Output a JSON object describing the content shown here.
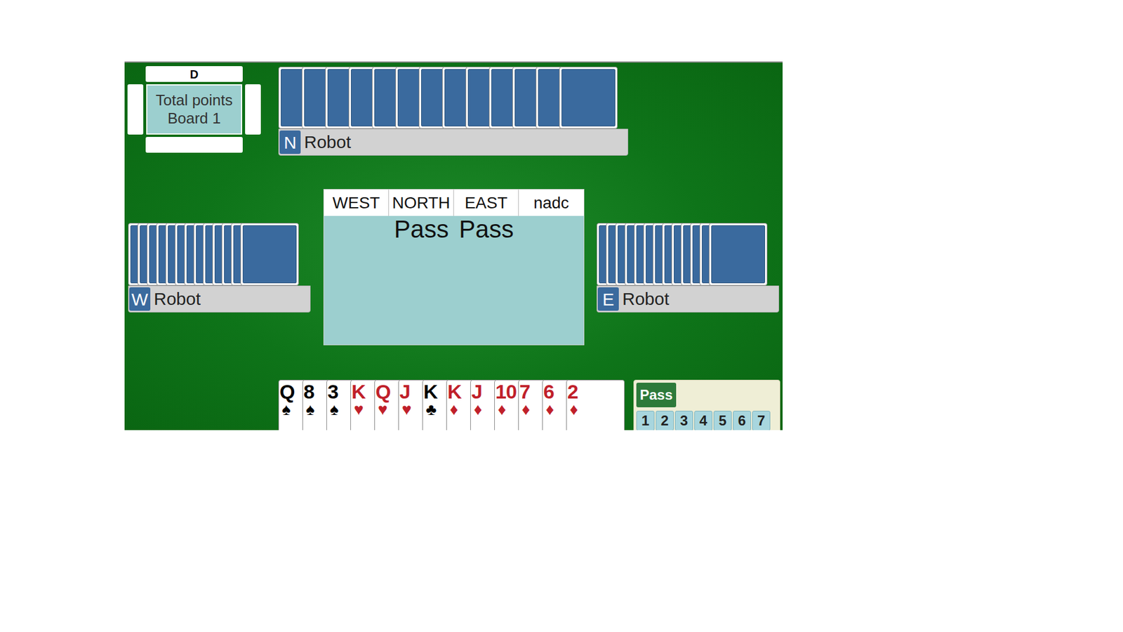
{
  "board": {
    "dealer_label": "D",
    "title": "Total points",
    "board": "Board 1"
  },
  "players": [
    {
      "seat": "N",
      "name": "Robot",
      "cards": 13
    },
    {
      "seat": "W",
      "name": "Robot",
      "cards": 13
    },
    {
      "seat": "E",
      "name": "Robot",
      "cards": 13
    }
  ],
  "auction": {
    "columns": [
      "WEST",
      "NORTH",
      "EAST",
      "nadc"
    ],
    "calls": [
      {
        "column": "NORTH",
        "text": "Pass"
      },
      {
        "column": "EAST",
        "text": "Pass"
      }
    ]
  },
  "hand": [
    {
      "rank": "Q",
      "suit": "♠",
      "color": "#000000"
    },
    {
      "rank": "8",
      "suit": "♠",
      "color": "#000000"
    },
    {
      "rank": "3",
      "suit": "♠",
      "color": "#000000"
    },
    {
      "rank": "K",
      "suit": "♥",
      "color": "#c0202a"
    },
    {
      "rank": "Q",
      "suit": "♥",
      "color": "#c0202a"
    },
    {
      "rank": "J",
      "suit": "♥",
      "color": "#c0202a"
    },
    {
      "rank": "K",
      "suit": "♣",
      "color": "#000000"
    },
    {
      "rank": "K",
      "suit": "♦",
      "color": "#c0202a"
    },
    {
      "rank": "J",
      "suit": "♦",
      "color": "#c0202a"
    },
    {
      "rank": "10",
      "suit": "♦",
      "color": "#c0202a"
    },
    {
      "rank": "7",
      "suit": "♦",
      "color": "#c0202a"
    },
    {
      "rank": "6",
      "suit": "♦",
      "color": "#c0202a"
    },
    {
      "rank": "2",
      "suit": "♦",
      "color": "#c0202a"
    }
  ],
  "bidding_box": {
    "pass": "Pass",
    "levels": [
      "1",
      "2",
      "3",
      "4",
      "5",
      "6",
      "7"
    ]
  }
}
